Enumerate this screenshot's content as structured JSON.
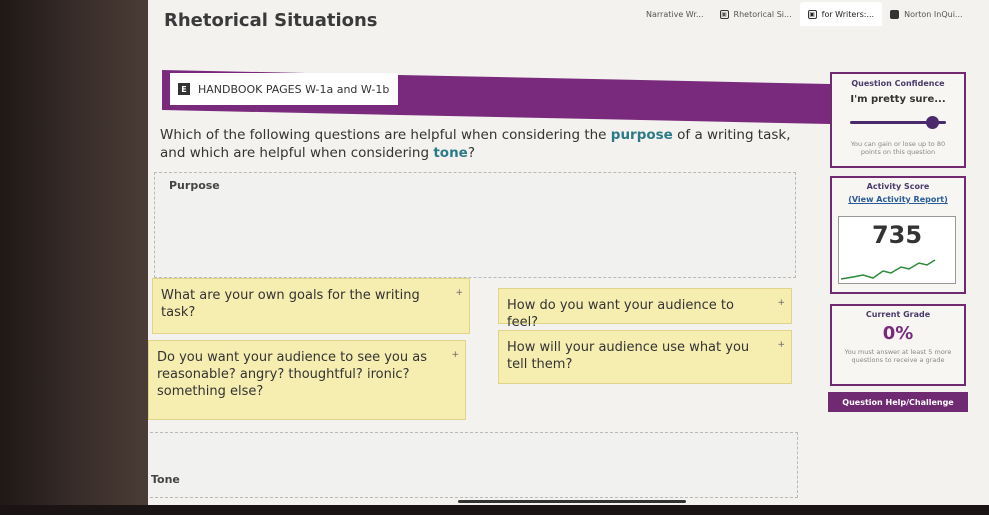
{
  "tabs": [
    {
      "label": "Narrative Wr...",
      "icon": "document-icon"
    },
    {
      "label": "Rhetorical Si...",
      "icon": "document-icon"
    },
    {
      "label": "for Writers:...",
      "icon": "document-icon"
    },
    {
      "label": "Norton InQui...",
      "icon": "document-icon"
    }
  ],
  "page": {
    "title": "Rhetorical Situations"
  },
  "handbook": {
    "icon_glyph": "E",
    "label": "HANDBOOK PAGES W-1a and W-1b"
  },
  "question": {
    "part1": "Which of the following questions are helpful when considering the ",
    "kw1": "purpose",
    "part2": " of a writing task, and which are helpful when considering ",
    "kw2": "tone",
    "part3": "?"
  },
  "zones": {
    "purpose_label": "Purpose",
    "tone_label": "Tone"
  },
  "cards": [
    {
      "text": "What are your own goals for the writing task?",
      "plus": "+"
    },
    {
      "text": "How do you want your audience to feel?",
      "plus": "+"
    },
    {
      "text": "How will your audience use what you tell them?",
      "plus": "+"
    },
    {
      "text": "Do you want your audience to see you as reasonable? angry? thoughtful? ironic? something else?",
      "plus": "+"
    }
  ],
  "confidence": {
    "heading": "Question Confidence",
    "value": "I'm pretty sure...",
    "level": 0.85,
    "note": "You can gain or lose up to 80 points on this question"
  },
  "activity": {
    "heading": "Activity Score",
    "link": "(View Activity Report)",
    "score": "735"
  },
  "grade": {
    "heading": "Current Grade",
    "value": "0%",
    "note": "You must answer at least 5 more questions to receive a grade"
  },
  "help_button": "Question Help/Challenge",
  "colors": {
    "accent": "#7a2a7c",
    "keyword": "#2d7a87",
    "card": "#f6edb0"
  }
}
